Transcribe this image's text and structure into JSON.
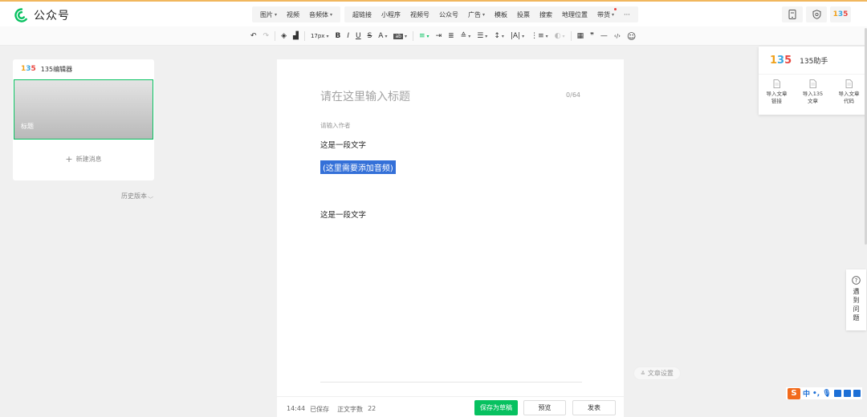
{
  "header": {
    "brand": "公众号",
    "insert_items": [
      {
        "label": "图片",
        "dropdown": true
      },
      {
        "label": "视频",
        "dropdown": false
      },
      {
        "label": "音频体",
        "dropdown": true
      }
    ],
    "insert_items2": [
      {
        "label": "超链接",
        "dropdown": false
      },
      {
        "label": "小程序",
        "dropdown": false
      },
      {
        "label": "视频号",
        "dropdown": false
      },
      {
        "label": "公众号",
        "dropdown": false
      },
      {
        "label": "广告",
        "dropdown": true
      },
      {
        "label": "模板",
        "dropdown": false
      },
      {
        "label": "投票",
        "dropdown": false
      },
      {
        "label": "搜索",
        "dropdown": false
      },
      {
        "label": "地理位置",
        "dropdown": false
      },
      {
        "label": "带货",
        "dropdown": true
      }
    ],
    "more": "···",
    "right_icons": [
      "phone-preview-icon",
      "shield-icon",
      "135-logo-icon"
    ]
  },
  "format_toolbar": {
    "font_size": "17px",
    "bold": "B",
    "italic": "I",
    "underline": "U",
    "strike": "S",
    "font_color": "A",
    "quote": "❞",
    "hr": "—",
    "code": "‹/›",
    "emoji": "☺"
  },
  "left_panel": {
    "logo": "135",
    "title": "135编辑器",
    "cover_label": "标题",
    "new_message": "新建消息",
    "history": "历史版本"
  },
  "editor": {
    "title_placeholder": "请在这里输入标题",
    "title_count": "0/64",
    "author_placeholder": "请输入作者",
    "paragraph1": "这是一段文字",
    "audio_placeholder": "(这里需要添加音频)",
    "paragraph2": "这是一段文字"
  },
  "bottom_bar": {
    "time": "14:44",
    "saved": "已保存",
    "word_count_label": "正文字数",
    "word_count": "22",
    "save_draft": "保存为草稿",
    "preview": "预览",
    "publish": "发表"
  },
  "article_settings": "文章设置",
  "helper": {
    "logo": "135",
    "title": "135助手",
    "actions": [
      "导入文章\n链接",
      "导入135\n文章",
      "导入文章\n代码"
    ]
  },
  "feedback": "遇到问题",
  "ime": {
    "label": "中"
  },
  "colors": {
    "brand_green": "#07c160",
    "highlight_blue": "#3470d8",
    "top_accent": "#f1b75e",
    "logo_1": "#f0a11b",
    "logo_3": "#3aa7e0",
    "logo_5": "#e9463f"
  }
}
